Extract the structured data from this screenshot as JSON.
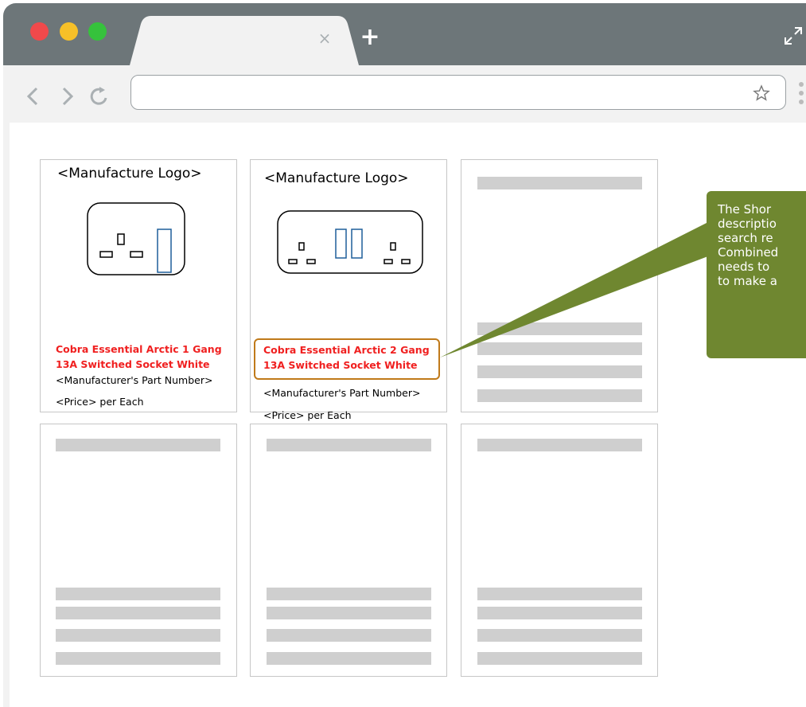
{
  "browser": {
    "tab_close_glyph": "×",
    "new_tab_glyph": "+",
    "address_value": "",
    "traffic_lights": [
      "#f0494b",
      "#f7c028",
      "#36c23c"
    ]
  },
  "cards": [
    {
      "logo": "<Manufacture Logo>",
      "name_line1": "Cobra Essential Arctic 1 Gang",
      "name_line2": "13A Switched Socket White",
      "part_number": "<Manufacturer's Part Number>",
      "price": "<Price> per Each"
    },
    {
      "logo": "<Manufacture Logo>",
      "name_line1": "Cobra Essential Arctic 2 Gang",
      "name_line2": "13A Switched Socket White",
      "part_number": "<Manufacturer's Part Number>",
      "price": "<Price> per Each"
    }
  ],
  "callout": {
    "lines": [
      "The Shor",
      "descriptio",
      "search re",
      "Combined",
      "needs to",
      "to make a"
    ],
    "color": "#6f8730"
  },
  "highlight_color": "#c07a1a",
  "product_name_color": "#f02020"
}
